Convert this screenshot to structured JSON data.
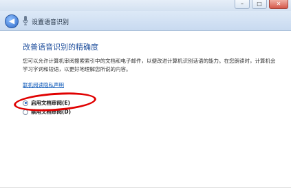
{
  "nav": {
    "back_icon": "back-arrow-icon",
    "title": "设置语音识别"
  },
  "main": {
    "heading": "改善语音识别的精确度",
    "description": "您可以允许计算机审阅搜索索引中的文档和电子邮件，以便改进计算机识别话语的能力。在您朗读时，计算机会学习字词和短语，以更好地理解您所说的内容。",
    "privacy_link": "联机阅读隐私声明",
    "options": [
      {
        "label": "启用文档审阅(E)",
        "checked": true
      },
      {
        "label": "禁用文档审阅(D)",
        "checked": false
      }
    ]
  },
  "annotation": {
    "color": "#e00000"
  }
}
